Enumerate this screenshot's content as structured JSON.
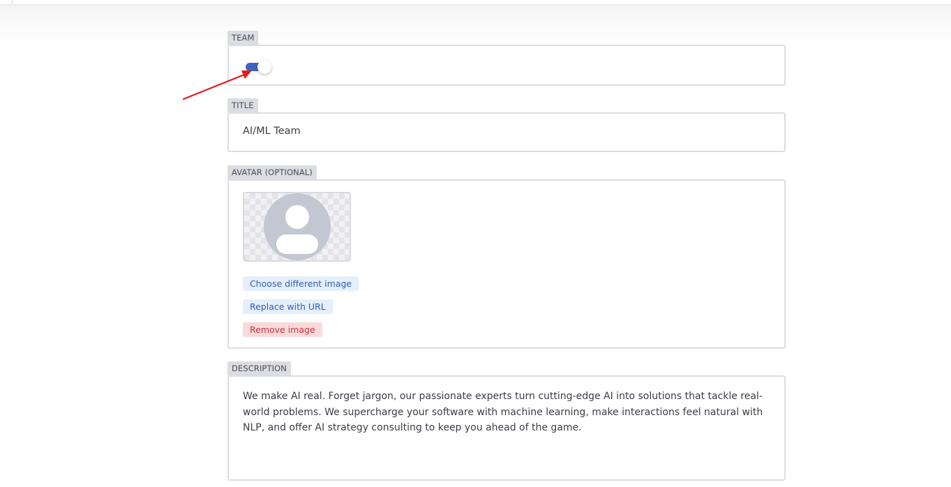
{
  "form": {
    "team": {
      "label": "TEAM",
      "toggle_on": true,
      "accent_color": "#3d64c4"
    },
    "title": {
      "label": "TITLE",
      "value": "AI/ML Team"
    },
    "avatar": {
      "label": "AVATAR (OPTIONAL)",
      "icon": "user-placeholder-icon",
      "choose_label": "Choose different image",
      "replace_label": "Replace with URL",
      "remove_label": "Remove image"
    },
    "description": {
      "label": "DESCRIPTION",
      "value": "We make AI real. Forget jargon, our passionate experts turn cutting-edge AI into solutions that tackle real-world problems. We supercharge your software with machine learning, make interactions feel natural with NLP, and offer AI strategy consulting to keep you ahead of the game."
    }
  },
  "annotation": {
    "arrow_color": "#e31b1b",
    "icon": "arrow-pointer-icon"
  },
  "colors": {
    "label_bg": "#dcdde2",
    "link_blue": "#2f5db4",
    "danger_red": "#cf2f3b"
  }
}
